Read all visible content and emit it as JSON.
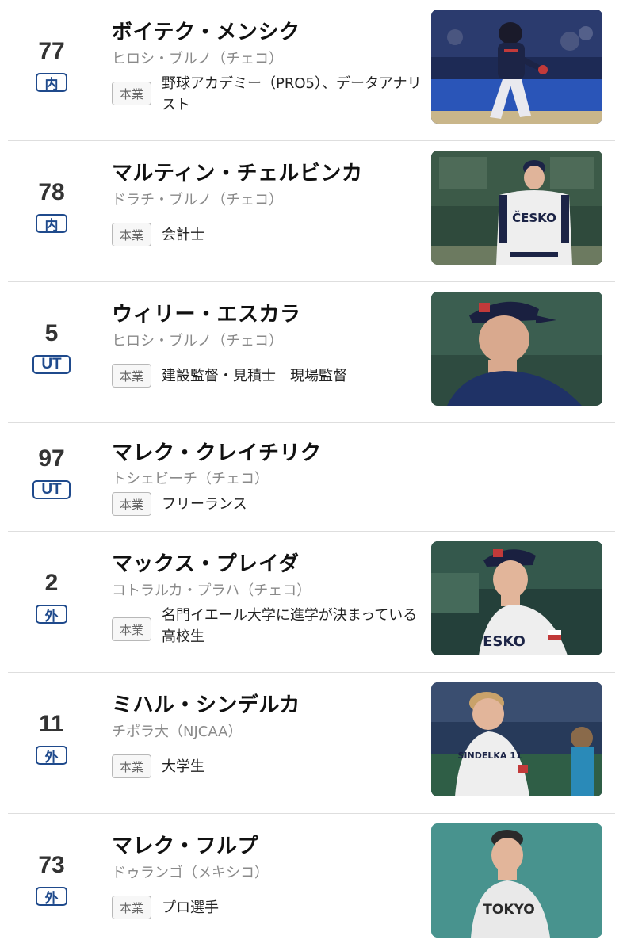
{
  "players": [
    {
      "number": "77",
      "position": "内",
      "name": "ボイテク・メンシク",
      "team": "ヒロシ・ブルノ（チェコ）",
      "job_label": "本業",
      "job": "野球アカデミー（PRO5）、データアナリスト",
      "photo": true,
      "jersey_text": ""
    },
    {
      "number": "78",
      "position": "内",
      "name": "マルティン・チェルビンカ",
      "team": "ドラチ・ブルノ（チェコ）",
      "job_label": "本業",
      "job": "会計士",
      "photo": true,
      "jersey_text": "ČESKO"
    },
    {
      "number": "5",
      "position": "UT",
      "name": "ウィリー・エスカラ",
      "team": "ヒロシ・ブルノ（チェコ）",
      "job_label": "本業",
      "job": "建設監督・見積士　現場監督",
      "photo": true,
      "jersey_text": ""
    },
    {
      "number": "97",
      "position": "UT",
      "name": "マレク・クレイチリク",
      "team": "トシェビーチ（チェコ）",
      "job_label": "本業",
      "job": "フリーランス",
      "photo": false,
      "jersey_text": ""
    },
    {
      "number": "2",
      "position": "外",
      "name": "マックス・プレイダ",
      "team": "コトラルカ・プラハ（チェコ）",
      "job_label": "本業",
      "job": "名門イエール大学に進学が決まっている高校生",
      "photo": true,
      "jersey_text": "ESKO"
    },
    {
      "number": "11",
      "position": "外",
      "name": "ミハル・シンデルカ",
      "team": "チポラ大（NJCAA）",
      "job_label": "本業",
      "job": "大学生",
      "photo": true,
      "jersey_text": "SINDELKA 11"
    },
    {
      "number": "73",
      "position": "外",
      "name": "マレク・フルプ",
      "team": "ドゥランゴ（メキシコ）",
      "job_label": "本業",
      "job": "プロ選手",
      "photo": true,
      "jersey_text": "TOKYO"
    }
  ],
  "colors": {
    "position_badge": "#1f4a8c",
    "team_text": "#8a8a8a",
    "divider": "#dedede"
  }
}
